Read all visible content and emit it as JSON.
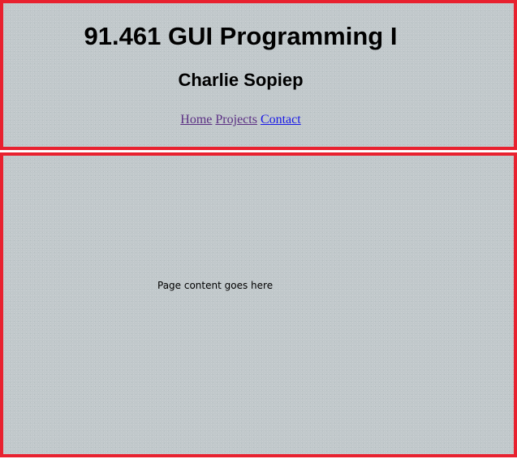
{
  "header": {
    "title": "91.461 GUI Programming I",
    "author": "Charlie Sopiep",
    "nav": [
      {
        "label": "Home"
      },
      {
        "label": "Projects"
      },
      {
        "label": "Contact"
      }
    ]
  },
  "content": {
    "text": "Page content goes here"
  },
  "colors": {
    "panel_border": "#e8212f",
    "panel_background": "#c1c8cb",
    "visited_link": "#5b2f83",
    "link": "#1a1ae6"
  }
}
